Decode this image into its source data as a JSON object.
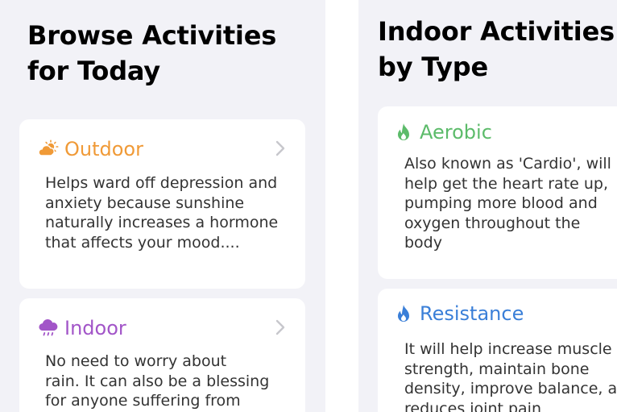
{
  "left_screen": {
    "title_line1": "Browse Activities",
    "title_line2": "for Today",
    "cards": [
      {
        "title": "Outdoor",
        "icon": "sun-behind-cloud-icon",
        "color": "#f09a37",
        "lines": [
          "Helps ward off depression and",
          "anxiety because sunshine",
          "naturally increases a hormone",
          "that affects your mood...."
        ]
      },
      {
        "title": "Indoor",
        "icon": "cloud-rain-icon",
        "color": "#a255c8",
        "lines": [
          "No need to worry about",
          "rain. It can also be a blessing",
          "for anyone suffering from"
        ]
      }
    ]
  },
  "right_screen": {
    "title_line1": "Indoor Activities",
    "title_line2": "by Type",
    "cards": [
      {
        "title": "Aerobic",
        "icon": "flame-icon",
        "color": "#5cbb6a",
        "lines": [
          "Also known as 'Cardio', will",
          "help get the heart rate up,",
          "pumping more blood and",
          "oxygen throughout the",
          "body"
        ]
      },
      {
        "title": "Resistance",
        "icon": "flame-icon",
        "color": "#3a7fd8",
        "lines": [
          "It will help increase muscle",
          "strength, maintain bone",
          "density, improve balance, and",
          "reduces joint pain"
        ]
      }
    ]
  }
}
